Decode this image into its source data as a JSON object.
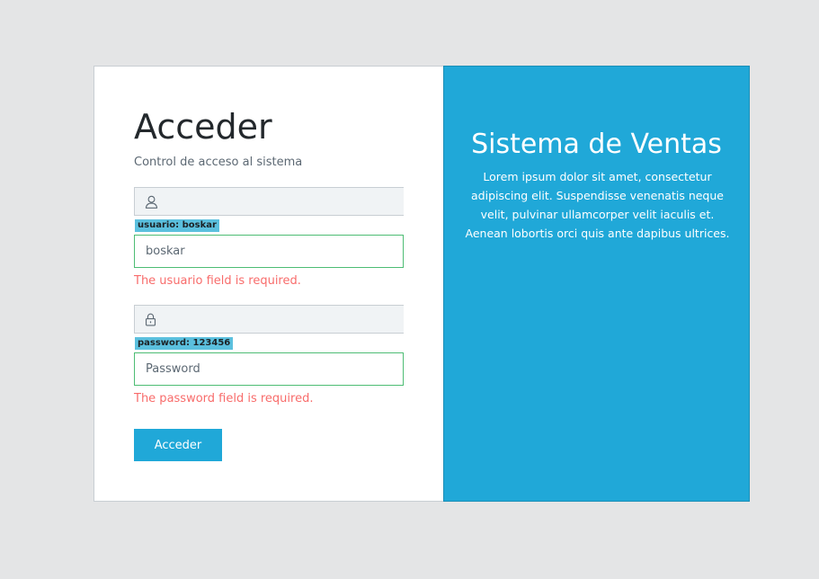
{
  "login": {
    "title": "Acceder",
    "subtitle": "Control de acceso al sistema",
    "username_tag": "usuario: boskar",
    "username_value": "boskar",
    "username_error": "The usuario field is required.",
    "password_tag": "password: 123456",
    "password_placeholder": "Password",
    "password_error": "The password field is required.",
    "submit_label": "Acceder",
    "icons": {
      "username": "user-icon",
      "password": "lock-icon"
    }
  },
  "info": {
    "title": "Sistema de Ventas",
    "description": "Lorem ipsum dolor sit amet, consectetur adipiscing elit. Suspendisse venenatis neque velit, pulvinar ullamcorper velit iaculis et. Aenean lobortis orci quis ante dapibus ultrices."
  },
  "colors": {
    "primary": "#20a8d8",
    "valid_border": "#4dbd74",
    "error": "#f86c6b",
    "debug_tag": "#5bc0de",
    "background": "#e4e5e6"
  }
}
